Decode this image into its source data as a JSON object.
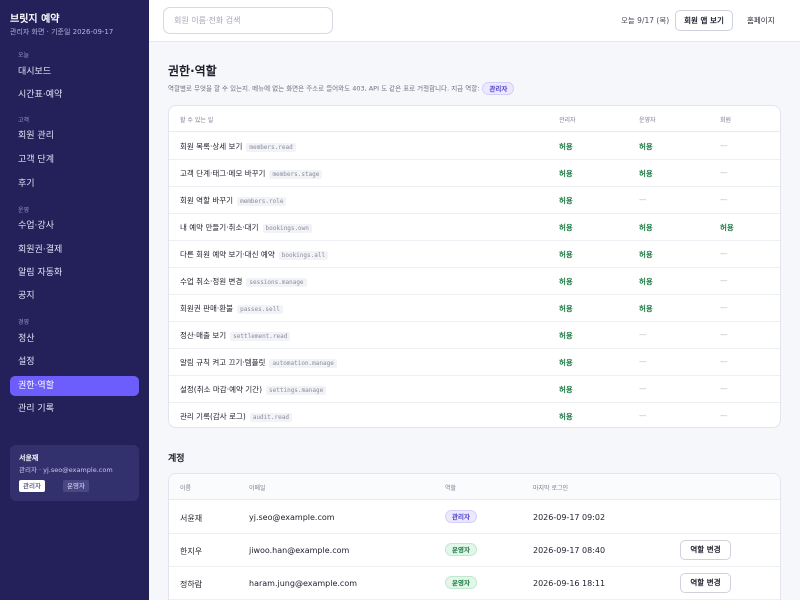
{
  "sidebar": {
    "brand": "브릿지 예약",
    "subtitle": "관리자 화면 · 기준일 2026-09-17",
    "sections": {
      "today": "오늘",
      "customers": "고객",
      "operations": "운영",
      "management": "경영"
    },
    "items": [
      {
        "label": "대시보드"
      },
      {
        "label": "시간표·예약"
      },
      {
        "label": "회원 관리"
      },
      {
        "label": "고객 단계"
      },
      {
        "label": "후기"
      },
      {
        "label": "수업·강사"
      },
      {
        "label": "회원권·결제"
      },
      {
        "label": "알림 자동화"
      },
      {
        "label": "공지"
      },
      {
        "label": "정산"
      },
      {
        "label": "설정"
      },
      {
        "label": "권한·역할",
        "active": true
      },
      {
        "label": "관리 기록"
      }
    ],
    "user": {
      "name": "서윤재",
      "meta": "관리자 · yj.seo@example.com",
      "roles": [
        "관리자",
        "운영자"
      ],
      "active_role": "관리자"
    }
  },
  "topbar": {
    "search_placeholder": "회원 이름·전화 검색",
    "search_value": "",
    "today": "오늘 9/17 (목)",
    "member_app_button": "회원 앱 보기",
    "homepage_link": "홈페이지"
  },
  "permissions": {
    "title": "권한·역할",
    "description": "역할별로 무엇을 할 수 있는지. 메뉴에 없는 화면은 주소로 들어와도 403, API 도 같은 표로 거절합니다. 지금 역할:",
    "current_role": "관리자",
    "headers": {
      "action": "할 수 있는 일",
      "admin": "관리자",
      "operator": "운영자",
      "member": "회원"
    },
    "allow_text": "허용",
    "deny_text": "—",
    "rows": [
      {
        "label": "회원 목록·상세 보기",
        "code": "members.read",
        "admin": true,
        "operator": true,
        "member": false
      },
      {
        "label": "고객 단계·태그·메모 바꾸기",
        "code": "members.stage",
        "admin": true,
        "operator": true,
        "member": false
      },
      {
        "label": "회원 역할 바꾸기",
        "code": "members.role",
        "admin": true,
        "operator": false,
        "member": false
      },
      {
        "label": "내 예약 만들기·취소·대기",
        "code": "bookings.own",
        "admin": true,
        "operator": true,
        "member": true
      },
      {
        "label": "다른 회원 예약 보기·대신 예약",
        "code": "bookings.all",
        "admin": true,
        "operator": true,
        "member": false
      },
      {
        "label": "수업 취소·정원 변경",
        "code": "sessions.manage",
        "admin": true,
        "operator": true,
        "member": false
      },
      {
        "label": "회원권 판매·환불",
        "code": "passes.sell",
        "admin": true,
        "operator": true,
        "member": false
      },
      {
        "label": "정산·매출 보기",
        "code": "settlement.read",
        "admin": true,
        "operator": false,
        "member": false
      },
      {
        "label": "알림 규칙 켜고 끄기·템플릿",
        "code": "automation.manage",
        "admin": true,
        "operator": false,
        "member": false
      },
      {
        "label": "설정(취소 마감·예약 기간)",
        "code": "settings.manage",
        "admin": true,
        "operator": false,
        "member": false
      },
      {
        "label": "관리 기록(감사 로그)",
        "code": "audit.read",
        "admin": true,
        "operator": false,
        "member": false
      }
    ]
  },
  "accounts": {
    "title": "계정",
    "headers": {
      "name": "이름",
      "email": "이메일",
      "role": "역할",
      "last_login": "마지막 로그인"
    },
    "change_role_label": "역할 변경",
    "rows": [
      {
        "name": "서윤재",
        "email": "yj.seo@example.com",
        "role": "관리자",
        "role_type": "admin",
        "last_login": "2026-09-17 09:02",
        "can_change": false
      },
      {
        "name": "한지우",
        "email": "jiwoo.han@example.com",
        "role": "운영자",
        "role_type": "op",
        "last_login": "2026-09-17 08:40",
        "can_change": true
      },
      {
        "name": "정하람",
        "email": "haram.jung@example.com",
        "role": "운영자",
        "role_type": "op",
        "last_login": "2026-09-16 18:11",
        "can_change": true
      }
    ]
  },
  "colors": {
    "sidebar_bg": "#23205a",
    "accent": "#6d5dfc",
    "allow_green": "#1b7a45",
    "admin_badge": "#4b3fc9",
    "operator_badge": "#1b7a45"
  }
}
